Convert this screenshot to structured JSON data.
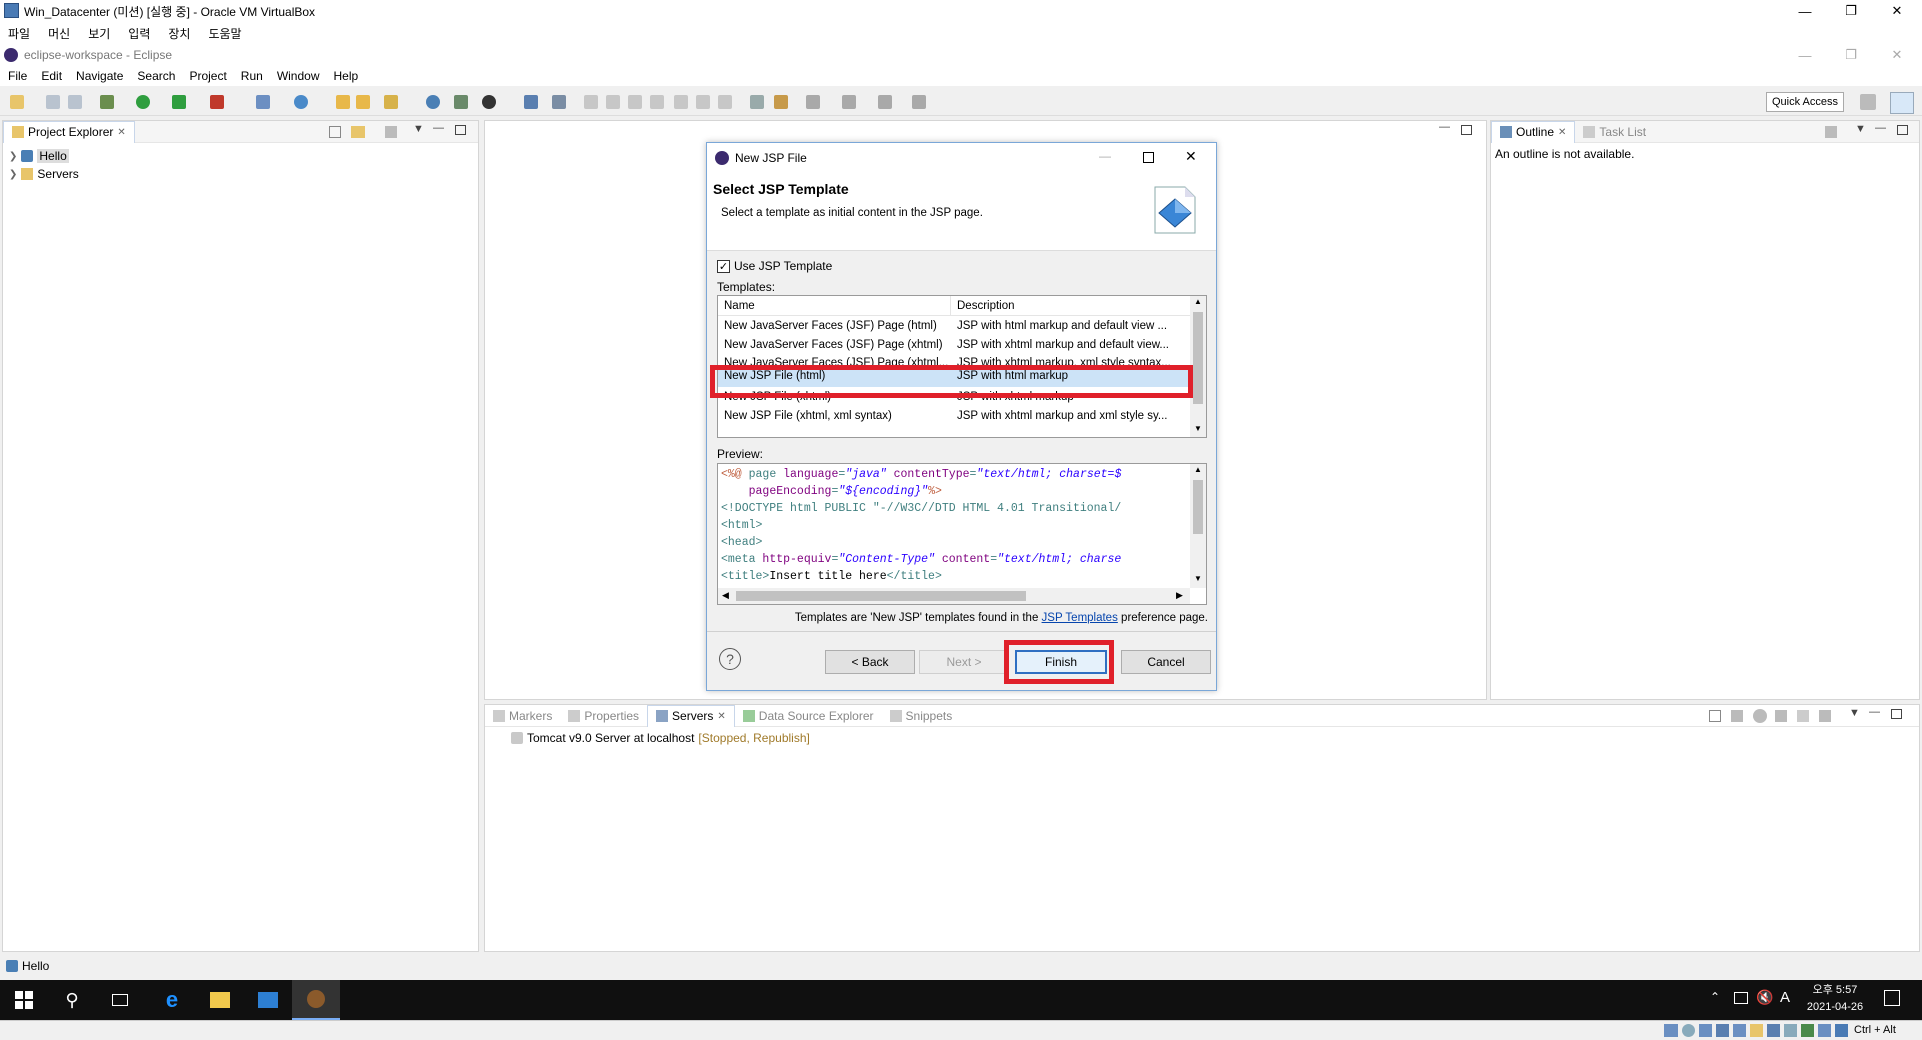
{
  "vbox": {
    "title": "Win_Datacenter (미션) [실행 중] - Oracle VM VirtualBox",
    "menu": [
      "파일",
      "머신",
      "보기",
      "입력",
      "장치",
      "도움말"
    ]
  },
  "eclipse": {
    "title": "eclipse-workspace - Eclipse",
    "menu": [
      "File",
      "Edit",
      "Navigate",
      "Search",
      "Project",
      "Run",
      "Window",
      "Help"
    ],
    "quick_access": "Quick Access",
    "project_explorer": {
      "tab": "Project Explorer",
      "items": [
        "Hello",
        "Servers"
      ]
    },
    "outline": {
      "tab": "Outline",
      "tab2": "Task List",
      "message": "An outline is not available."
    },
    "bottom_tabs": [
      "Markers",
      "Properties",
      "Servers",
      "Data Source Explorer",
      "Snippets"
    ],
    "server_entry": "Tomcat v9.0 Server at localhost",
    "server_status": "[Stopped, Republish]",
    "status_bar": "Hello"
  },
  "dialog": {
    "title": "New JSP File",
    "heading": "Select JSP Template",
    "subheading": "Select a template as initial content in the JSP page.",
    "use_template_label": "Use JSP Template",
    "templates_label": "Templates:",
    "col_name": "Name",
    "col_desc": "Description",
    "rows": [
      {
        "name": "New JavaServer Faces (JSF) Page (html)",
        "desc": "JSP with html markup and default view ..."
      },
      {
        "name": "New JavaServer Faces (JSF) Page (xhtml)",
        "desc": "JSP with xhtml markup and default view..."
      },
      {
        "name": "New JavaServer Faces (JSF) Page (xhtml...",
        "desc": "JSP with xhtml markup, xml style syntax..."
      },
      {
        "name": "New JSP File (html)",
        "desc": "JSP with html markup"
      },
      {
        "name": "New JSP File (xhtml)",
        "desc": "JSP with xhtml markup"
      },
      {
        "name": "New JSP File (xhtml, xml syntax)",
        "desc": "JSP with xhtml markup and xml style sy..."
      }
    ],
    "preview_label": "Preview:",
    "footer_prefix": "Templates are 'New JSP' templates found in the",
    "footer_link": "JSP Templates",
    "footer_suffix": "preference page.",
    "buttons": {
      "back": "< Back",
      "next": "Next >",
      "finish": "Finish",
      "cancel": "Cancel"
    }
  },
  "taskbar": {
    "time": "오후 5:57",
    "date": "2021-04-26",
    "hostkey": "Ctrl + Alt"
  }
}
